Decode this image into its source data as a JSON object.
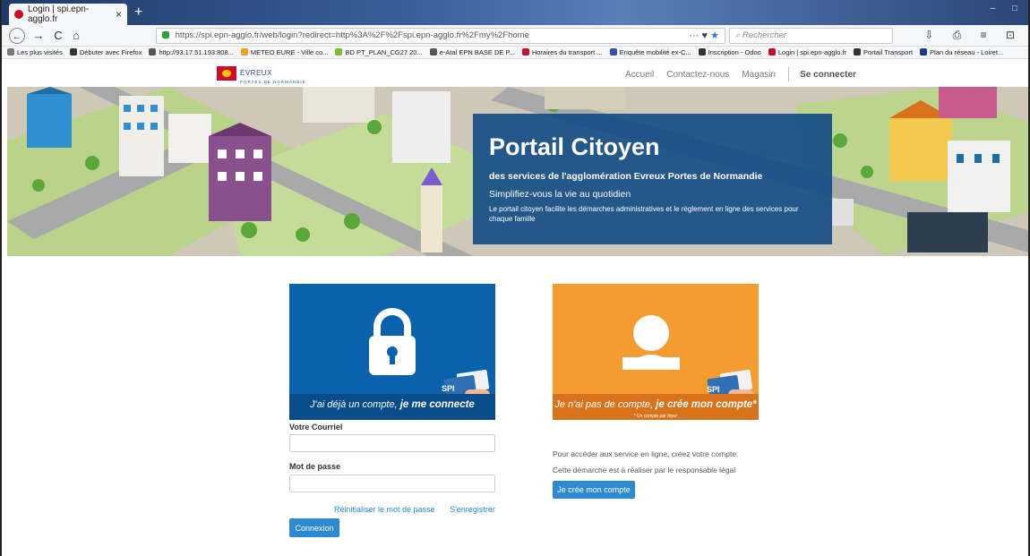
{
  "browser": {
    "tab_title": "Login | spi.epn-agglo.fr",
    "tab_close": "×",
    "new_tab": "+",
    "window_controls": "– □",
    "back": "←",
    "forward": "→",
    "reload": "C",
    "home": "⌂",
    "url": "https://spi.epn-agglo.fr/web/login?redirect=http%3A%2F%2Fspi.epn-agglo.fr%2Fmy%2Fhome",
    "url_actions": "··· ♥",
    "url_star": "★",
    "search_placeholder": "Rechercher",
    "tool_icons": "⇩ ⎙ ≡ ⊡",
    "bookmarks": [
      {
        "label": "Les plus visités",
        "color": "#777777"
      },
      {
        "label": "Débuter avec Firefox",
        "color": "#333333"
      },
      {
        "label": "http://93.17.51.193:808...",
        "color": "#555555"
      },
      {
        "label": "METEO EURE - Ville co...",
        "color": "#f0a020"
      },
      {
        "label": "BD PT_PLAN_CG27 20...",
        "color": "#7cbf2a"
      },
      {
        "label": "e-Atal EPN BASE DE P...",
        "color": "#555555"
      },
      {
        "label": "Horaires du transport ...",
        "color": "#c8102e"
      },
      {
        "label": "Enquête mobilité ex-C...",
        "color": "#3a4fb0"
      },
      {
        "label": "Inscription - Odoo",
        "color": "#333333"
      },
      {
        "label": "Login | spi.epn-agglo.fr",
        "color": "#c8102e"
      },
      {
        "label": "Portail Transport",
        "color": "#333333"
      },
      {
        "label": "Plan du réseau - Loiret...",
        "color": "#1f3a8c"
      }
    ]
  },
  "site": {
    "logo_name": "ÉVREUX",
    "logo_tagline": "PORTES DE NORMANDIE",
    "nav": {
      "home": "Accueil",
      "contact": "Contactez-nous",
      "shop": "Magasin",
      "login": "Se connecter"
    }
  },
  "hero": {
    "title": "Portail Citoyen",
    "subtitle": "des services de l'agglomération Evreux Portes de Normandie",
    "tagline": "Simplifiez-vous la vie au quotidien",
    "description": "Le portail citoyen facilite les démarches administratives et le règlement en ligne des services pour chaque famille"
  },
  "login_card": {
    "caption_prefix": "J'ai déjà un compte,",
    "caption_bold": "je me connecte",
    "icon": "lock-icon",
    "card_brand": "SPI",
    "color": "#0a62ad"
  },
  "signup_card": {
    "caption_prefix": "Je n'ai pas de compte,",
    "caption_bold": "je crée mon compte*",
    "caption_note": "* Un compte par foyer",
    "icon": "user-icon",
    "card_brand": "SPI",
    "color": "#f59b2f"
  },
  "login_form": {
    "email_label": "Votre Courriel",
    "email_value": "",
    "password_label": "Mot de passe",
    "password_value": "",
    "reset_link": "Réinitialiser le mot de passe",
    "register_link": "S'enregistrer",
    "submit_label": "Connexion"
  },
  "signup_info": {
    "line1": "Pour accéder aux service en ligne, créez votre compte.",
    "line2": "Cette démarche est à réaliser par le responsable légal",
    "button_label": "Je crée mon compte"
  }
}
